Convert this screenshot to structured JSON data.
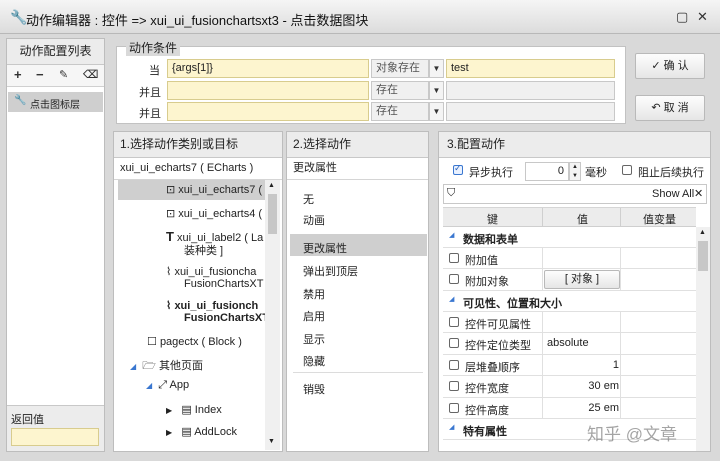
{
  "window": {
    "title": "动作编辑器 : 控件 => xui_ui_fusionchartsxt3 - 点击数据图块"
  },
  "left_panel": {
    "title": "动作配置列表",
    "item": "点击图标层",
    "return_label": "返回值"
  },
  "conditions": {
    "legend": "动作条件",
    "rows": [
      {
        "label": "当",
        "value": "{args[1]}",
        "operator": "对象存在",
        "target": "test"
      },
      {
        "label": "并且",
        "value": "",
        "operator": "存在",
        "target": ""
      },
      {
        "label": "并且",
        "value": "",
        "operator": "存在",
        "target": ""
      }
    ],
    "ok_label": "确 认",
    "cancel_label": "取 消"
  },
  "col1": {
    "title": "1.选择动作类别或目标",
    "subtitle": "xui_ui_echarts7 ( ECharts )",
    "items": [
      {
        "icon": "component-icon",
        "glyph": "⊡",
        "text": "xui_ui_echarts7 ("
      },
      {
        "icon": "component-icon",
        "glyph": "⊡",
        "text": "xui_ui_echarts4 ("
      },
      {
        "icon": "text-icon",
        "glyph": "T",
        "text": "xui_ui_label2 ( La",
        "text2": "装种类 ]"
      },
      {
        "icon": "chart-icon",
        "glyph": "⌇",
        "text": "xui_ui_fusioncha",
        "text2": "FusionChartsXT"
      },
      {
        "icon": "chart-icon",
        "glyph": "⌇",
        "text": "xui_ui_fusionch",
        "text2": "FusionChartsXT"
      },
      {
        "icon": "block-icon",
        "glyph": "☐",
        "text": "pagectx ( Block )"
      },
      {
        "icon": "folder-icon",
        "glyph": "🗁",
        "text": "其他页面"
      },
      {
        "icon": "app-icon",
        "glyph": "⤢",
        "text": "App"
      },
      {
        "icon": "page-icon",
        "glyph": "▤",
        "text": "Index"
      },
      {
        "icon": "page-icon",
        "glyph": "▤",
        "text": "AddLock"
      }
    ]
  },
  "col2": {
    "title": "2.选择动作",
    "subtitle": "更改属性",
    "items": [
      "无",
      "动画",
      "更改属性",
      "弹出到顶层",
      "禁用",
      "启用",
      "显示",
      "隐藏",
      "销毁"
    ]
  },
  "col3": {
    "title": "3.配置动作",
    "async_label": "异步执行",
    "delay_value": "0",
    "ms_label": "毫秒",
    "block_label": "阻止后续执行",
    "show_all": "Show All",
    "headers": [
      "键",
      "值",
      "值变量"
    ],
    "rows": [
      {
        "type": "section",
        "key": "数据和表单"
      },
      {
        "type": "prop",
        "key": "附加值",
        "value": ""
      },
      {
        "type": "prop",
        "key": "附加对象",
        "value": "[ 对象 ]",
        "button": true
      },
      {
        "type": "section",
        "key": "可见性、位置和大小"
      },
      {
        "type": "prop",
        "key": "控件可见属性",
        "value": ""
      },
      {
        "type": "prop",
        "key": "控件定位类型",
        "value": "absolute"
      },
      {
        "type": "prop",
        "key": "层堆叠顺序",
        "value": "1",
        "align": "right"
      },
      {
        "type": "prop",
        "key": "控件宽度",
        "value": "30 em",
        "align": "right"
      },
      {
        "type": "prop",
        "key": "控件高度",
        "value": "25 em",
        "align": "right"
      },
      {
        "type": "section",
        "key": "特有属性"
      }
    ]
  },
  "watermark": "知乎 @文章"
}
